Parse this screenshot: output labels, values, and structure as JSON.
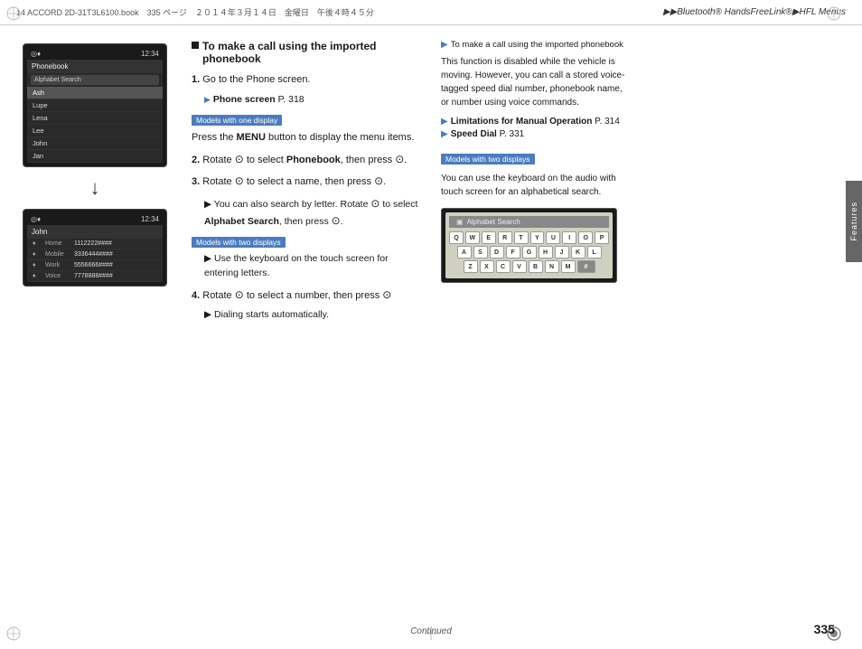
{
  "header": {
    "print_info": "14 ACCORD 2D-31T3L6100.book　335 ページ　２０１４年３月１４日　金曜日　午後４時４５分",
    "title": "▶▶Bluetooth® HandsFreeLink®▶HFL Menus"
  },
  "left_panel": {
    "screen1": {
      "title": "Phonebook",
      "time": "12:34",
      "icon_bar": "◎♦",
      "search_label": "Alphabet Search",
      "items": [
        "Ash",
        "Lupe",
        "Lena",
        "Lee",
        "John",
        "Jan"
      ]
    },
    "screen2": {
      "title": "John",
      "time": "12:34",
      "icon_bar": "◎♦",
      "contacts": [
        {
          "icon": "♦",
          "type": "Home",
          "number": "1112222####"
        },
        {
          "icon": "♦",
          "type": "Mobile",
          "number": "3336444####"
        },
        {
          "icon": "♦",
          "type": "Work",
          "number": "5556666####"
        },
        {
          "icon": "♦",
          "type": "Voice",
          "number": "7778888####"
        }
      ]
    }
  },
  "middle_panel": {
    "section_title": "To make a call using the imported phonebook",
    "steps": [
      {
        "num": "1.",
        "text": "Go to the Phone screen.",
        "ref": "Phone screen P. 318"
      },
      {
        "badge": "Models with one display",
        "text": "Press the MENU button to display the menu items."
      },
      {
        "num": "2.",
        "text": "Rotate",
        "icon": "⊙",
        "text2": "to select Phonebook, then press",
        "icon2": "⊙"
      },
      {
        "num": "3.",
        "text": "Rotate",
        "icon": "⊙",
        "text2": "to select a name, then press",
        "icon2": "⊙"
      },
      {
        "sub1": "▶ You can also search by letter. Rotate",
        "icon": "⊙",
        "sub2": "to select Alphabet Search, then press",
        "icon2": "⊙"
      },
      {
        "badge": "Models with two displays",
        "text": "▶ Use the keyboard on the touch screen for entering letters."
      },
      {
        "num": "4.",
        "text": "Rotate",
        "icon": "⊙",
        "text2": "to select a number, then press",
        "icon2": "⊙"
      },
      {
        "sub1": "▶ Dialing starts automatically."
      }
    ]
  },
  "right_panel": {
    "note_header": "▶To make a call using the imported phonebook",
    "note_body": "This function is disabled while the vehicle is moving. However, you can call a stored voice-tagged speed dial number, phonebook name, or number using voice commands.",
    "refs": [
      {
        "arrow": "▶",
        "text": "Limitations for Manual Operation",
        "page": "P. 314"
      },
      {
        "arrow": "▶",
        "text": "Speed Dial",
        "page": "P. 331"
      }
    ],
    "badge_two": "Models with two displays",
    "two_display_text": "You can use the keyboard on the audio with touch screen for an alphabetical search.",
    "alphabet_screen": {
      "title": "Alphabet Search",
      "rows": [
        [
          "Q",
          "W",
          "E",
          "R",
          "T",
          "Y",
          "U",
          "I",
          "O",
          "P"
        ],
        [
          "A",
          "S",
          "D",
          "F",
          "G",
          "H",
          "J",
          "K",
          "L",
          ""
        ],
        [
          "Z",
          "X",
          "C",
          "V",
          "B",
          "N",
          "M",
          "#"
        ]
      ]
    }
  },
  "footer": {
    "continued": "Continued",
    "page_number": "335"
  }
}
